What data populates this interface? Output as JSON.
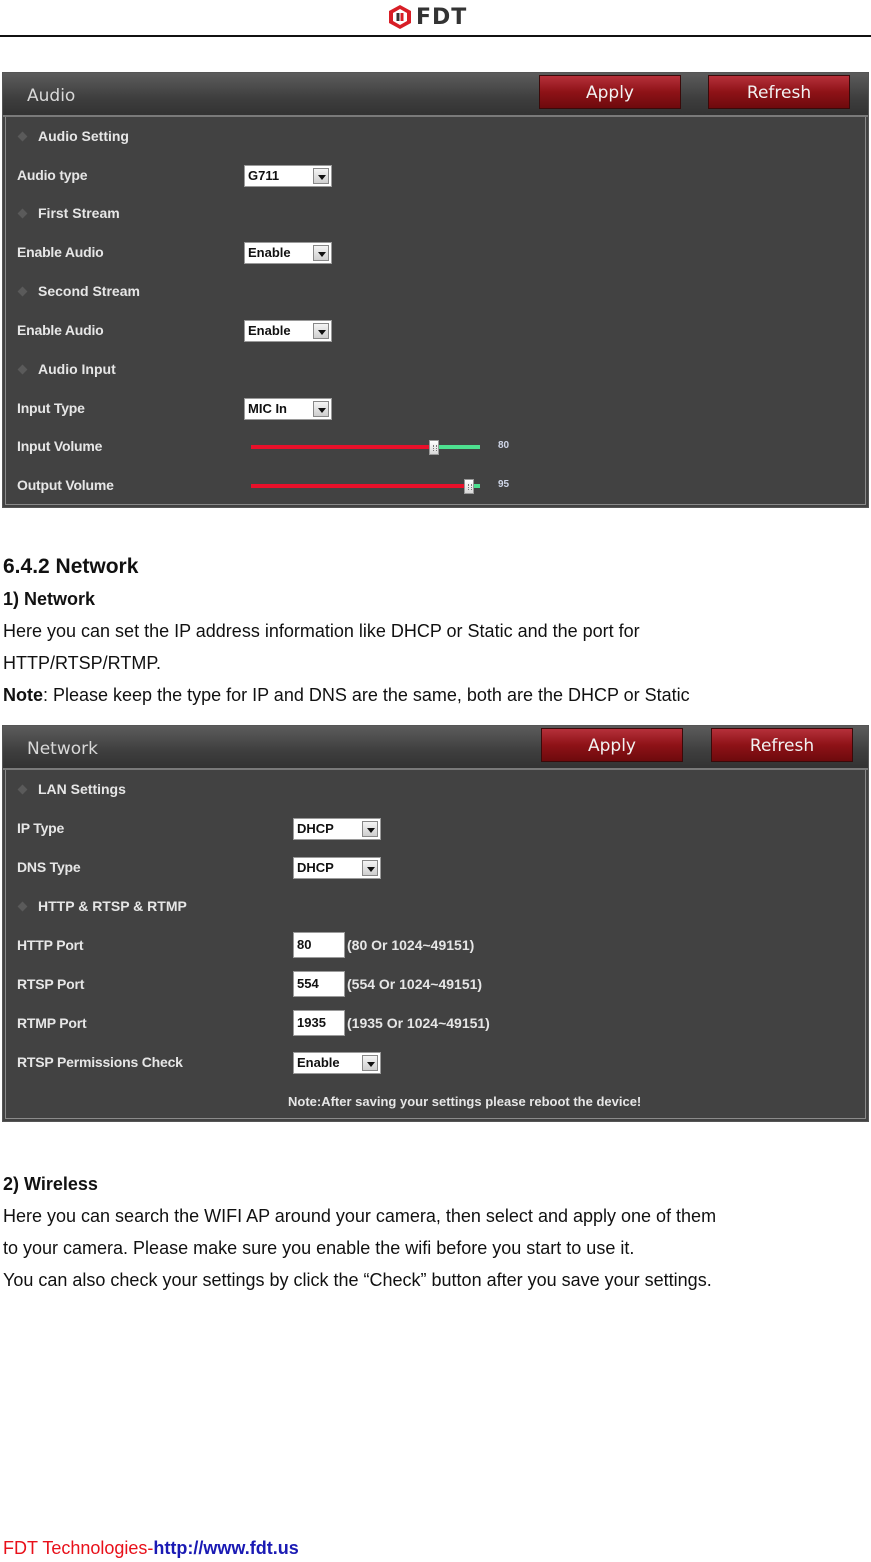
{
  "header": {
    "logo_text": "FDT",
    "logo_icon": "fdt-hexagon-logo-icon"
  },
  "audio_panel": {
    "title": "Audio",
    "apply_label": "Apply",
    "refresh_label": "Refresh",
    "sections": {
      "audio_setting": "Audio Setting",
      "first_stream": "First Stream",
      "second_stream": "Second Stream",
      "audio_input": "Audio Input"
    },
    "fields": {
      "audio_type": {
        "label": "Audio type",
        "value": "G711"
      },
      "first_enable_audio": {
        "label": "Enable Audio",
        "value": "Enable"
      },
      "second_enable_audio": {
        "label": "Enable Audio",
        "value": "Enable"
      },
      "input_type": {
        "label": "Input Type",
        "value": "MIC In"
      },
      "input_volume": {
        "label": "Input Volume",
        "value": 80,
        "value_text": "80",
        "max": 100
      },
      "output_volume": {
        "label": "Output Volume",
        "value": 95,
        "value_text": "95",
        "max": 100
      }
    }
  },
  "network_section": {
    "heading": "6.4.2 Network",
    "sub_heading": "1) Network",
    "para_line1": "Here you can set the IP address information like DHCP or Static and the port for",
    "para_line2": "HTTP/RTSP/RTMP.",
    "note_bold": "Note",
    "note_rest": ": Please keep the type for IP and DNS are the same, both are the DHCP or Static"
  },
  "network_panel": {
    "title": "Network",
    "apply_label": "Apply",
    "refresh_label": "Refresh",
    "sections": {
      "lan_settings": "LAN Settings",
      "ports": "HTTP & RTSP & RTMP"
    },
    "fields": {
      "ip_type": {
        "label": "IP Type",
        "value": "DHCP"
      },
      "dns_type": {
        "label": "DNS Type",
        "value": "DHCP"
      },
      "http_port": {
        "label": "HTTP Port",
        "value": "80",
        "hint": "(80 Or 1024~49151)"
      },
      "rtsp_port": {
        "label": "RTSP Port",
        "value": "554",
        "hint": "(554 Or 1024~49151)"
      },
      "rtmp_port": {
        "label": "RTMP Port",
        "value": "1935",
        "hint": "(1935 Or 1024~49151)"
      },
      "rtsp_permissions": {
        "label": "RTSP Permissions Check",
        "value": "Enable"
      }
    },
    "note": "Note:After saving your settings please reboot the device!"
  },
  "wireless_section": {
    "sub_heading": "2) Wireless",
    "line1": "Here you can search the WIFI AP around your camera, then select and apply one of them",
    "line2": "to your camera. Please make sure you enable the wifi before you start to use it.",
    "line3": "You can also check your settings by click the “Check” button after you save your settings."
  },
  "footer": {
    "company": "FDT Technologies-",
    "url": "http://www.fdt.us"
  },
  "colors": {
    "button_red": "#8e1217",
    "slider_red": "#e8102a",
    "slider_green": "#4de08f",
    "panel_bg": "#424242",
    "footer_red": "#e8101a",
    "footer_blue": "#1a1ab4"
  }
}
